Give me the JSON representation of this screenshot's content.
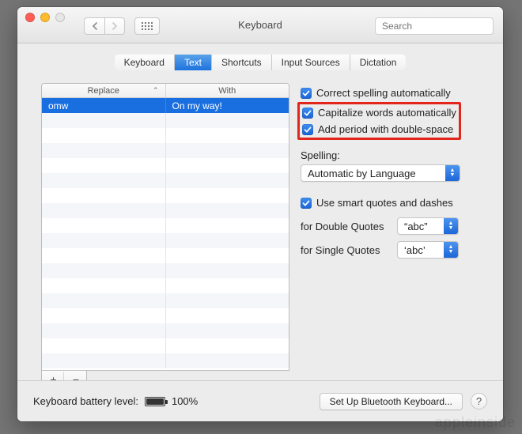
{
  "window": {
    "title": "Keyboard"
  },
  "search": {
    "placeholder": "Search"
  },
  "tabs": {
    "items": [
      "Keyboard",
      "Text",
      "Shortcuts",
      "Input Sources",
      "Dictation"
    ],
    "active": "Text"
  },
  "table": {
    "columns": {
      "replace": "Replace",
      "with": "With"
    },
    "rows": [
      {
        "replace": "omw",
        "with": "On my way!",
        "selected": true
      }
    ],
    "add": "+",
    "remove": "−"
  },
  "options": {
    "correct_spelling": "Correct spelling automatically",
    "capitalize": "Capitalize words automatically",
    "add_period": "Add period with double-space",
    "spelling_label": "Spelling:",
    "spelling_value": "Automatic by Language",
    "smart_quotes": "Use smart quotes and dashes",
    "double_label": "for Double Quotes",
    "double_value": "“abc”",
    "single_label": "for Single Quotes",
    "single_value": "‘abc’"
  },
  "footer": {
    "battery_label": "Keyboard battery level:",
    "battery_pct": "100%",
    "bluetooth_btn": "Set Up Bluetooth Keyboard...",
    "help": "?"
  },
  "watermark": "appleinside"
}
